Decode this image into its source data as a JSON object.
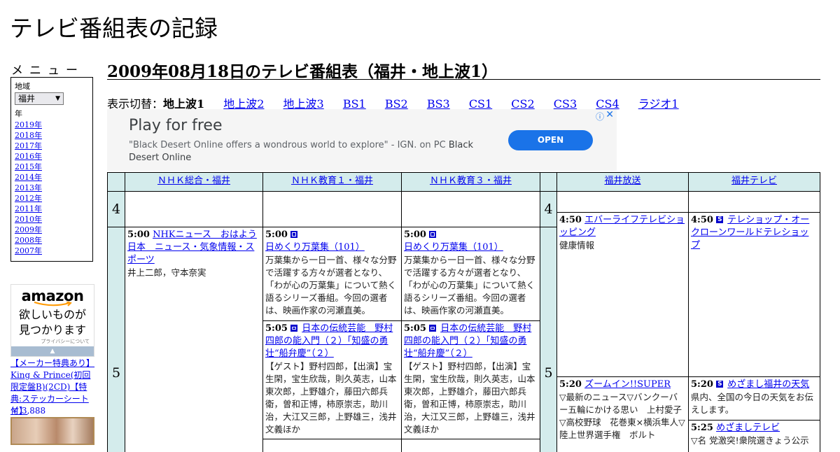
{
  "site": {
    "title": "テレビ番組表の記録"
  },
  "sidebar": {
    "menu_title": "メニュー",
    "region_label": "地域",
    "region_selected": "福井",
    "year_label": "年",
    "years": [
      "2019年",
      "2018年",
      "2017年",
      "2016年",
      "2015年",
      "2014年",
      "2013年",
      "2012年",
      "2011年",
      "2010年",
      "2009年",
      "2008年",
      "2007年"
    ]
  },
  "amazon": {
    "logo": "amazon",
    "slogan_line1": "欲しいものが",
    "slogan_line2": "見つかります",
    "privacy": "プライバシーについて",
    "product_text": "【メーカー特典あり】King & Prince(初回限定盤B)(2CD)【特典:ステッカーシート付】",
    "product_price": "￥ 3,888"
  },
  "main": {
    "title": "2009年08月18日のテレビ番組表（福井・地上波1）",
    "switch_label": "表示切替：",
    "switch_current": "地上波1",
    "switch_links": [
      "地上波2",
      "地上波3",
      "BS1",
      "BS2",
      "BS3",
      "CS1",
      "CS2",
      "CS3",
      "CS4",
      "ラジオ1"
    ]
  },
  "ad": {
    "headline": "Play for free",
    "body": "\"Black Desert Online offers a wondrous world to explore\" - IGN. on PC",
    "brand": "Black Desert Online",
    "button": "OPEN",
    "info_icon": "info-icon",
    "close_icon": "close-icon"
  },
  "schedule": {
    "channels": [
      "ＮＨＫ総合・福井",
      "ＮＨＫ教育１・福井",
      "ＮＨＫ教育３・福井",
      "福井放送",
      "福井テレビ"
    ],
    "hours": [
      "4",
      "5"
    ],
    "programs": {
      "nhk_sogo_500": {
        "time": "5:00",
        "title": "NHKニュース　おはよう日本　ニュース・気象情報・スポーツ",
        "desc": "井上二郎，守本奈実"
      },
      "etv1_500": {
        "time": "5:00",
        "title": "日めくり万葉集（101）",
        "desc": "万葉集から一日一首、様々な分野で活躍する方々が選者となり、「わが心の万葉集」について熱く語るシリーズ番組。今回の選者は、映画作家の河瀬直美。"
      },
      "etv1_505": {
        "time": "5:05",
        "title": "日本の伝統芸能　野村四郎の能入門（２）「知盛の勇壮“船弁慶”（２）",
        "desc": "【ゲスト】野村四郎，【出演】宝生閑，宝生欣哉，則久英志，山本東次郎，上野雄介，藤田六郎兵衛，曽和正博，柿原崇志，助川治，大江又三郎，上野雄三，浅井文義ほか"
      },
      "etv3_500": {
        "time": "5:00",
        "title": "日めくり万葉集（101）",
        "desc": "万葉集から一日一首、様々な分野で活躍する方々が選者となり、「わが心の万葉集」について熱く語るシリーズ番組。今回の選者は、映画作家の河瀬直美。"
      },
      "etv3_505": {
        "time": "5:05",
        "title": "日本の伝統芸能　野村四郎の能入門（２）「知盛の勇壮“船弁慶”（２）",
        "desc": "【ゲスト】野村四郎，【出演】宝生閑，宝生欣哉，則久英志，山本東次郎，上野雄介，藤田六郎兵衛，曽和正博，柿原崇志，助川治，大江又三郎，上野雄三，浅井文義ほか"
      },
      "fbc_450": {
        "time": "4:50",
        "title": "エバーライフテレビショッピング",
        "desc": "健康情報"
      },
      "fbc_520": {
        "time": "5:20",
        "title": "ズームイン!!SUPER",
        "desc": "▽最新のニュース▽バンクーバー五輪にかける思い　上村愛子▽高校野球　花巻東×横浜隼人▽陸上世界選手権　ボルト"
      },
      "ftv_450": {
        "time": "4:50",
        "title": "テレショップ・オークローンワールドテレショップ",
        "desc": ""
      },
      "ftv_520": {
        "time": "5:20",
        "title": "めざまし福井の天気",
        "desc": "県内、全国の今日の天気をお伝えします。"
      },
      "ftv_525": {
        "time": "5:25",
        "title": "めざましテレビ",
        "desc": "▽名 党激突!衆院選きょう公示"
      }
    }
  }
}
